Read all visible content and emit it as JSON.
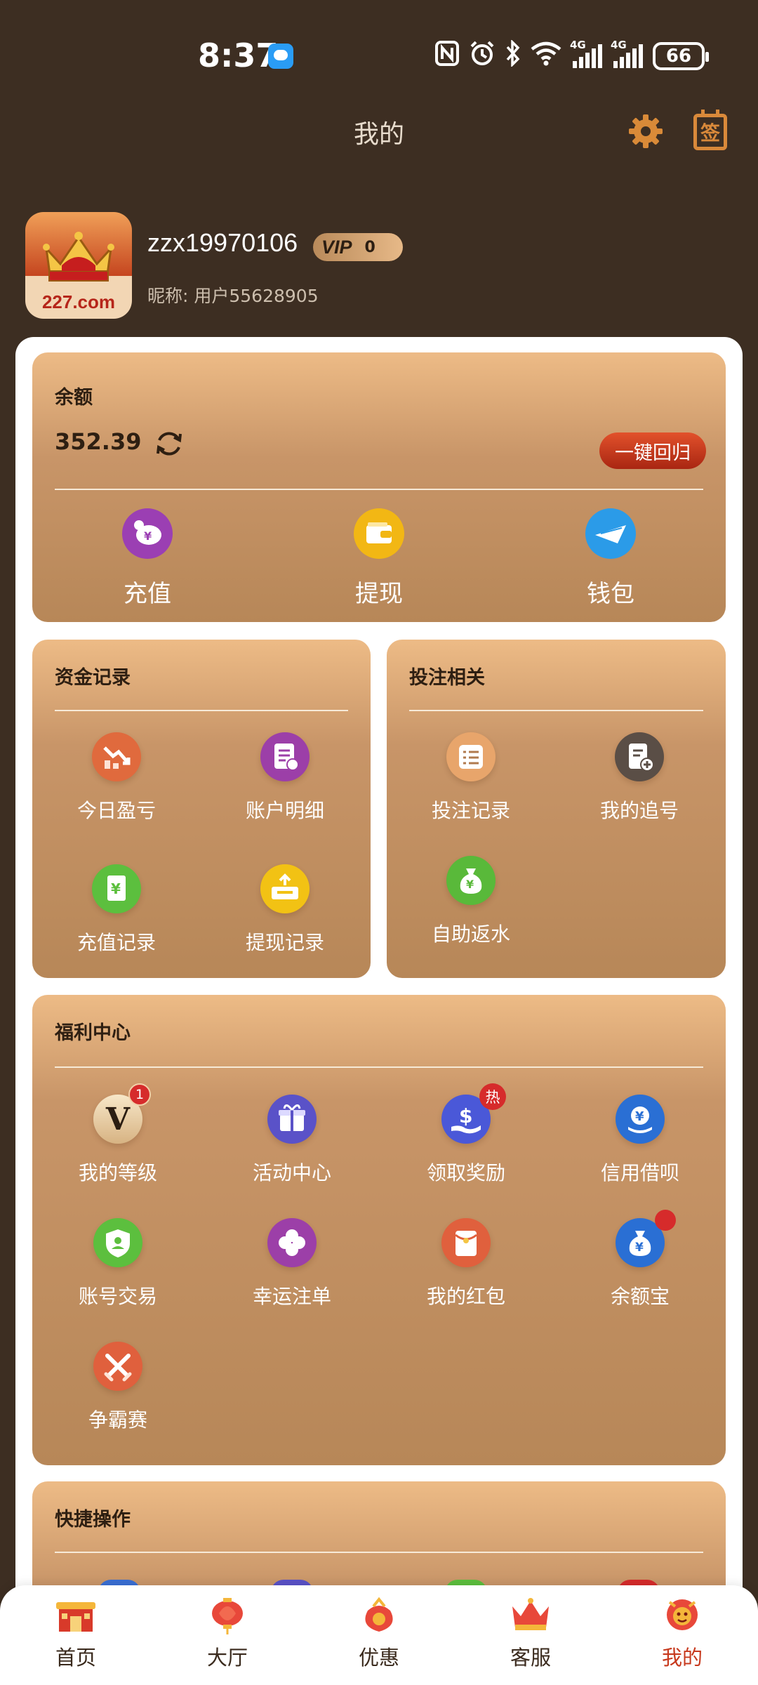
{
  "status_bar": {
    "time": "8:37",
    "network_1": "4G",
    "network_2": "4G",
    "battery": "66",
    "icons": [
      "message-icon",
      "nfc-icon",
      "alarm-icon",
      "bluetooth-icon",
      "wifi-icon",
      "signal-icon",
      "battery-icon"
    ]
  },
  "header": {
    "title": "我的",
    "sign_label": "签"
  },
  "profile": {
    "avatar_text": "227.com",
    "username": "zzx19970106",
    "vip_label": "VIP",
    "vip_level": "0",
    "nickname": "昵称: 用户55628905"
  },
  "balance": {
    "title": "余额",
    "value": "352.39",
    "return_button": "一键回归",
    "actions": [
      {
        "label": "充值",
        "icon": "piggy-bank-icon",
        "color": "#9b3fb3"
      },
      {
        "label": "提现",
        "icon": "wallet-icon",
        "color": "#f2b714"
      },
      {
        "label": "钱包",
        "icon": "paper-plane-icon",
        "color": "#2b9be8"
      }
    ]
  },
  "funds": {
    "title": "资金记录",
    "items": [
      {
        "label": "今日盈亏",
        "icon": "chart-down-icon",
        "color": "#e06a3d"
      },
      {
        "label": "账户明细",
        "icon": "ledger-icon",
        "color": "#9c3fa8"
      },
      {
        "label": "充值记录",
        "icon": "yuan-card-icon",
        "color": "#5cbf3e"
      },
      {
        "label": "提现记录",
        "icon": "upload-box-icon",
        "color": "#f2c214"
      }
    ]
  },
  "bets": {
    "title": "投注相关",
    "items": [
      {
        "label": "投注记录",
        "icon": "list-icon",
        "color": "#e8a56b"
      },
      {
        "label": "我的追号",
        "icon": "doc-add-icon",
        "color": "#5a4e46"
      },
      {
        "label": "自助返水",
        "icon": "money-bag-icon",
        "color": "#59b93a"
      }
    ]
  },
  "welfare": {
    "title": "福利中心",
    "items": [
      {
        "label": "我的等级",
        "icon": "vip-level-icon",
        "color": "#f0d9b5",
        "badge": "1"
      },
      {
        "label": "活动中心",
        "icon": "gift-icon",
        "color": "#5a52c8"
      },
      {
        "label": "领取奖励",
        "icon": "dollar-hand-icon",
        "color": "#4a58d8",
        "badge": "热"
      },
      {
        "label": "信用借呗",
        "icon": "yuan-shield-icon",
        "color": "#2a6fd4"
      },
      {
        "label": "账号交易",
        "icon": "user-shield-icon",
        "color": "#5cbf3e"
      },
      {
        "label": "幸运注单",
        "icon": "clover-icon",
        "color": "#9c3fa8"
      },
      {
        "label": "我的红包",
        "icon": "red-envelope-icon",
        "color": "#e0603d"
      },
      {
        "label": "余额宝",
        "icon": "yuan-bag-icon",
        "color": "#2a6fd4"
      },
      {
        "label": "争霸赛",
        "icon": "swords-icon",
        "color": "#e0603d"
      }
    ]
  },
  "shortcuts": {
    "title": "快捷操作"
  },
  "bottom_nav": {
    "items": [
      {
        "label": "首页",
        "icon": "home-gate-icon"
      },
      {
        "label": "大厅",
        "icon": "lantern-icon"
      },
      {
        "label": "优惠",
        "icon": "gift-bag-icon"
      },
      {
        "label": "客服",
        "icon": "crown-icon"
      },
      {
        "label": "我的",
        "icon": "profile-lion-icon",
        "active": true
      }
    ]
  }
}
